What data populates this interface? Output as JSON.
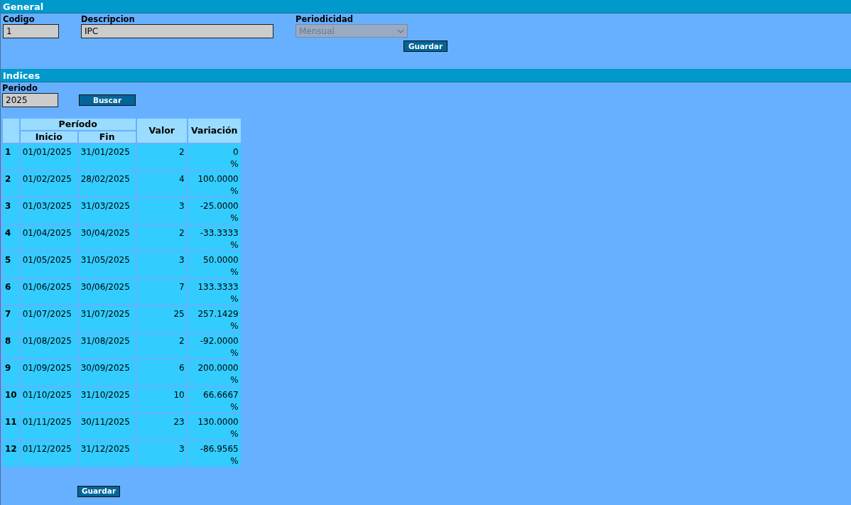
{
  "general": {
    "title": "General",
    "fields": [
      {
        "label": "Codigo",
        "value": "1",
        "kind": "text"
      },
      {
        "label": "Descripcion",
        "value": "IPC",
        "kind": "text"
      },
      {
        "label": "Periodicidad",
        "value": "Mensual",
        "kind": "select",
        "disabled": true
      }
    ],
    "save_button": "Guardar"
  },
  "indices": {
    "title": "Indices",
    "period": {
      "label": "Periodo",
      "value": "2025"
    },
    "search_button": "Buscar",
    "table": {
      "group_heading": "Período",
      "columns": [
        "Inicio",
        "Fin",
        "Valor",
        "Variación"
      ],
      "rows": [
        {
          "number": "1",
          "start": "01/01/2025",
          "end": "31/01/2025",
          "value": "2",
          "variation": "0",
          "unit": "%"
        },
        {
          "number": "2",
          "start": "01/02/2025",
          "end": "28/02/2025",
          "value": "4",
          "variation": "100.0000",
          "unit": "%"
        },
        {
          "number": "3",
          "start": "01/03/2025",
          "end": "31/03/2025",
          "value": "3",
          "variation": "-25.0000",
          "unit": "%"
        },
        {
          "number": "4",
          "start": "01/04/2025",
          "end": "30/04/2025",
          "value": "2",
          "variation": "-33.3333",
          "unit": "%"
        },
        {
          "number": "5",
          "start": "01/05/2025",
          "end": "31/05/2025",
          "value": "3",
          "variation": "50.0000",
          "unit": "%"
        },
        {
          "number": "6",
          "start": "01/06/2025",
          "end": "30/06/2025",
          "value": "7",
          "variation": "133.3333",
          "unit": "%"
        },
        {
          "number": "7",
          "start": "01/07/2025",
          "end": "31/07/2025",
          "value": "25",
          "variation": "257.1429",
          "unit": "%"
        },
        {
          "number": "8",
          "start": "01/08/2025",
          "end": "31/08/2025",
          "value": "2",
          "variation": "-92.0000",
          "unit": "%"
        },
        {
          "number": "9",
          "start": "01/09/2025",
          "end": "30/09/2025",
          "value": "6",
          "variation": "200.0000",
          "unit": "%"
        },
        {
          "number": "10",
          "start": "01/10/2025",
          "end": "31/10/2025",
          "value": "10",
          "variation": "66.6667",
          "unit": "%"
        },
        {
          "number": "11",
          "start": "01/11/2025",
          "end": "30/11/2025",
          "value": "23",
          "variation": "130.0000",
          "unit": "%"
        },
        {
          "number": "12",
          "start": "01/12/2025",
          "end": "31/12/2025",
          "value": "3",
          "variation": "-86.9565",
          "unit": "%"
        }
      ]
    },
    "save_button": "Guardar"
  }
}
